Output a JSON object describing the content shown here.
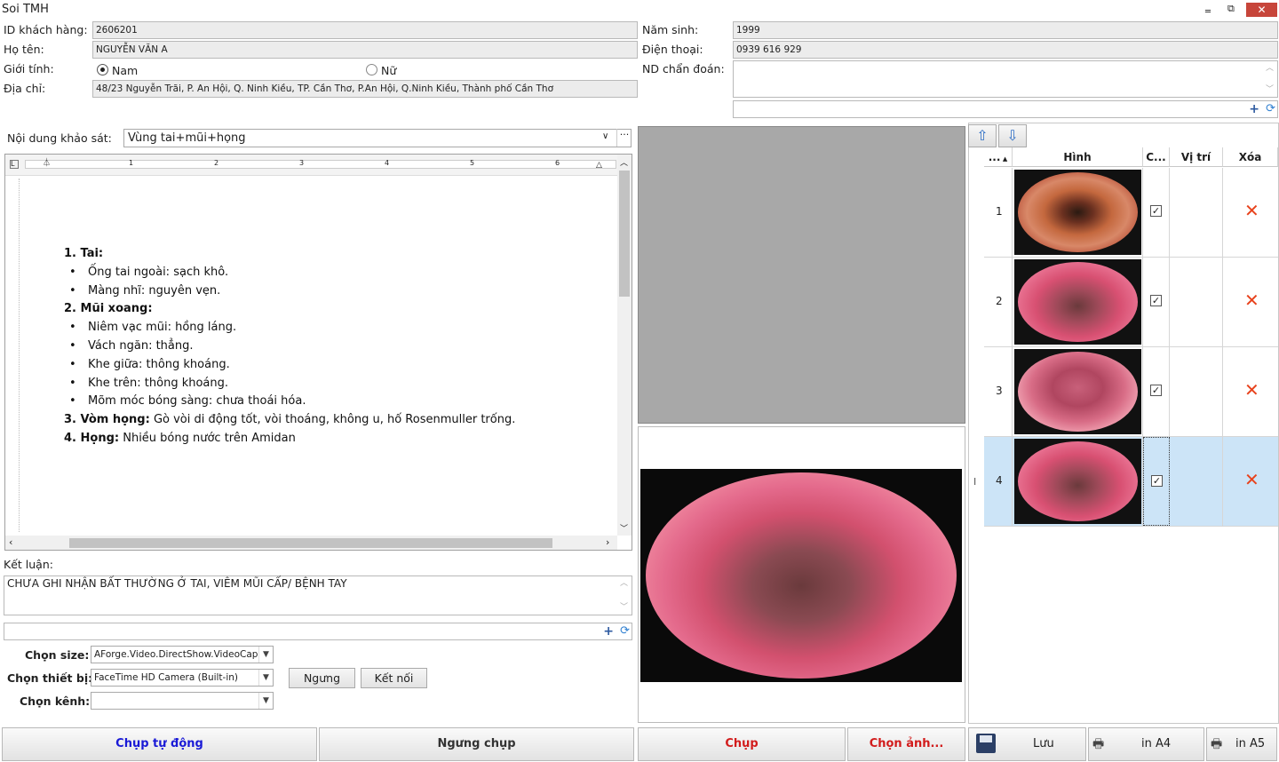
{
  "window": {
    "title": "Soi TMH"
  },
  "patient": {
    "id_label": "ID khách hàng:",
    "id_value": "2606201",
    "name_label": "Họ tên:",
    "name_value": "NGUYỄN VĂN A",
    "gender_label": "Giới tính:",
    "gender_male": "Nam",
    "gender_female": "Nữ",
    "gender_selected": "Nam",
    "address_label": "Địa chỉ:",
    "address_value": "48/23 Nguyễn Trãi, P. An Hội, Q. Ninh Kiều, TP. Cần Thơ, P.An Hội, Q.Ninh Kiều, Thành phố Cần Thơ",
    "birth_label": "Năm sinh:",
    "birth_value": "1999",
    "phone_label": "Điện thoại:",
    "phone_value": "0939 616 929",
    "diag_label": "ND chẩn đoán:"
  },
  "survey": {
    "label": "Nội dung khảo sát:",
    "value": "Vùng tai+mũi+họng"
  },
  "ruler": {
    "numbers": [
      "1",
      "2",
      "3",
      "4",
      "5",
      "6"
    ]
  },
  "editor": {
    "h1": "1. Tai:",
    "tai": [
      "Ống tai ngoài: sạch khô.",
      "Màng nhĩ: nguyên vẹn."
    ],
    "h2": "2. Mũi xoang:",
    "mui": [
      "Niêm vạc mũi: hồng láng.",
      "Vách ngăn: thẳng.",
      "Khe giữa: thông khoáng.",
      "Khe trên: thông khoáng.",
      "Mõm móc bóng sàng: chưa thoái hóa."
    ],
    "h3": "3. Vòm họng:",
    "t3": " Gò vòi di động tốt, vòi thoáng, không u, hố Rosenmuller trống.",
    "h4": "4. Họng:",
    "t4": " Nhiều bóng nước trên Amidan"
  },
  "conclusion": {
    "label": "Kết luận:",
    "value": "CHƯA GHI NHẬN BẤT THƯỜNG Ở TAI, VIÊM MŨI CẤP/ BỆNH TAY"
  },
  "device": {
    "size_label": "Chọn size:",
    "size_value": "AForge.Video.DirectShow.VideoCapab",
    "device_label": "Chọn thiết bị:",
    "device_value": "FaceTime HD Camera (Built-in)",
    "channel_label": "Chọn kênh:",
    "channel_value": "",
    "stop_label": "Ngưng",
    "connect_label": "Kết nối"
  },
  "grid": {
    "headers": [
      "...",
      "Hình",
      "C...",
      "Vị trí",
      "Xóa"
    ],
    "rows": [
      {
        "index": "1",
        "checked": true
      },
      {
        "index": "2",
        "checked": true
      },
      {
        "index": "3",
        "checked": true
      },
      {
        "index": "4",
        "checked": true
      }
    ],
    "selected_row": 4
  },
  "actions": {
    "auto_capture": "Chụp tự động",
    "stop_capture": "Ngưng chụp",
    "capture": "Chụp",
    "choose_image": "Chọn ảnh...",
    "save": "Lưu",
    "print_a4": "in A4",
    "print_a5": "in A5"
  },
  "colors": {
    "auto_capture": "#1a1ad6",
    "capture": "#d21c1c",
    "selected_row": "#cce4f7",
    "delete": "#e8421c"
  }
}
